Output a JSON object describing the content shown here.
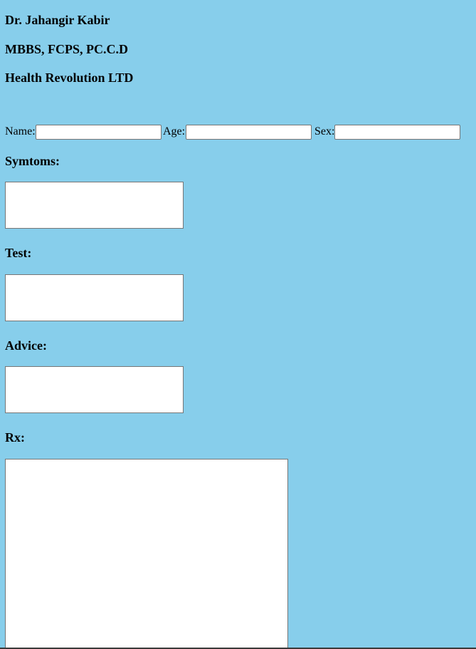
{
  "header": {
    "doctor_name": "Dr. Jahangir Kabir",
    "qualifications": "MBBS, FCPS, PC.C.D",
    "organization": "Health Revolution LTD"
  },
  "patient": {
    "name_label": "Name:",
    "name_value": "",
    "age_label": "Age:",
    "age_value": "",
    "sex_label": "Sex:",
    "sex_value": ""
  },
  "sections": {
    "symptoms_label": "Symtoms:",
    "symptoms_value": "",
    "test_label": "Test:",
    "test_value": "",
    "advice_label": "Advice:",
    "advice_value": "",
    "rx_label": "Rx:",
    "rx_value": ""
  },
  "colors": {
    "background": "#87ceeb",
    "field_background": "#ffffff",
    "field_border": "#767676"
  }
}
